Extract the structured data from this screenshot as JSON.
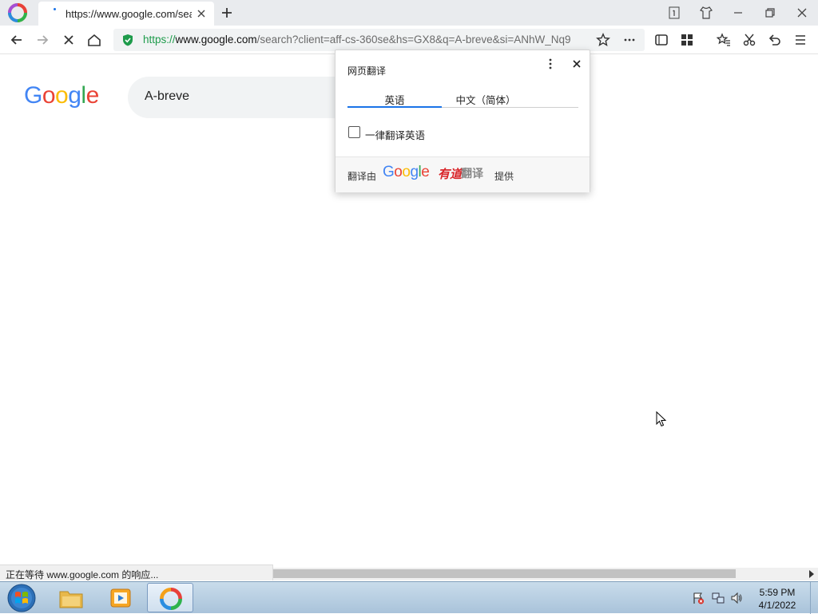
{
  "tab": {
    "title": "https://www.google.com/sea"
  },
  "address": {
    "scheme": "https://",
    "host": "www.google.com",
    "rest": "/search?client=aff-cs-360se&hs=GX8&q=A-breve&si=ANhW_Nq9"
  },
  "google": {
    "logo": [
      "G",
      "o",
      "o",
      "g",
      "l",
      "e"
    ],
    "logo_colors": [
      "#4285F4",
      "#EA4335",
      "#FBBC05",
      "#4285F4",
      "#34A853",
      "#EA4335"
    ],
    "search_query": "A-breve"
  },
  "translate": {
    "title": "网页翻译",
    "tab_source": "英语",
    "tab_target": "中文（简体）",
    "always_label": "一律翻译英语",
    "always_checked": false,
    "footer_prefix": "翻译由",
    "footer_google": "Google",
    "footer_youdao": "有道",
    "footer_fanyi": "翻译",
    "footer_suffix": "提供"
  },
  "status": {
    "text": "正在等待 www.google.com 的响应..."
  },
  "taskbar": {
    "time": "5:59 PM",
    "date": "4/1/2022"
  },
  "colors": {
    "accent": "#1a73e8",
    "https_green": "#1e9b4b",
    "youdao_red": "#d9252a"
  }
}
